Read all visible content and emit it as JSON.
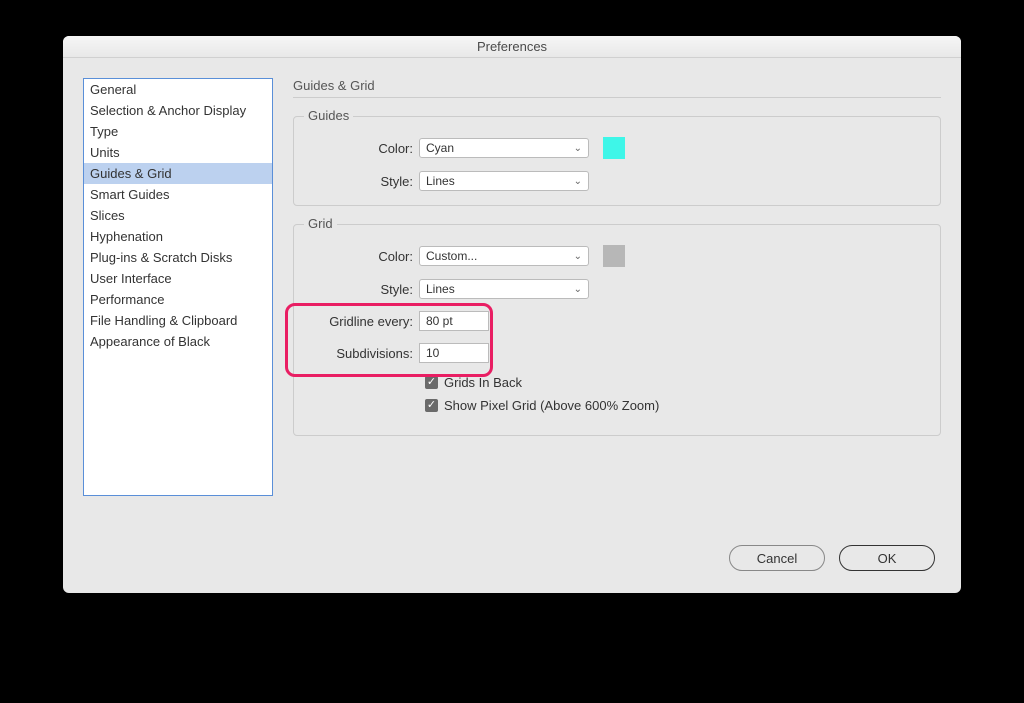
{
  "window": {
    "title": "Preferences"
  },
  "sidebar": {
    "items": [
      {
        "label": "General",
        "selected": false
      },
      {
        "label": "Selection & Anchor Display",
        "selected": false
      },
      {
        "label": "Type",
        "selected": false
      },
      {
        "label": "Units",
        "selected": false
      },
      {
        "label": "Guides & Grid",
        "selected": true
      },
      {
        "label": "Smart Guides",
        "selected": false
      },
      {
        "label": "Slices",
        "selected": false
      },
      {
        "label": "Hyphenation",
        "selected": false
      },
      {
        "label": "Plug-ins & Scratch Disks",
        "selected": false
      },
      {
        "label": "User Interface",
        "selected": false
      },
      {
        "label": "Performance",
        "selected": false
      },
      {
        "label": "File Handling & Clipboard",
        "selected": false
      },
      {
        "label": "Appearance of Black",
        "selected": false
      }
    ]
  },
  "panel": {
    "title": "Guides & Grid",
    "guides": {
      "legend": "Guides",
      "color_label": "Color:",
      "color_value": "Cyan",
      "color_swatch": "#3ef6e8",
      "style_label": "Style:",
      "style_value": "Lines"
    },
    "grid": {
      "legend": "Grid",
      "color_label": "Color:",
      "color_value": "Custom...",
      "color_swatch": "#b7b7b7",
      "style_label": "Style:",
      "style_value": "Lines",
      "gridline_label": "Gridline every:",
      "gridline_value": "80 pt",
      "subdiv_label": "Subdivisions:",
      "subdiv_value": "10",
      "grids_back_label": "Grids In Back",
      "pixel_grid_label": "Show Pixel Grid (Above 600% Zoom)"
    }
  },
  "footer": {
    "cancel": "Cancel",
    "ok": "OK"
  },
  "annotation": {
    "highlight_color": "#e91e63"
  }
}
